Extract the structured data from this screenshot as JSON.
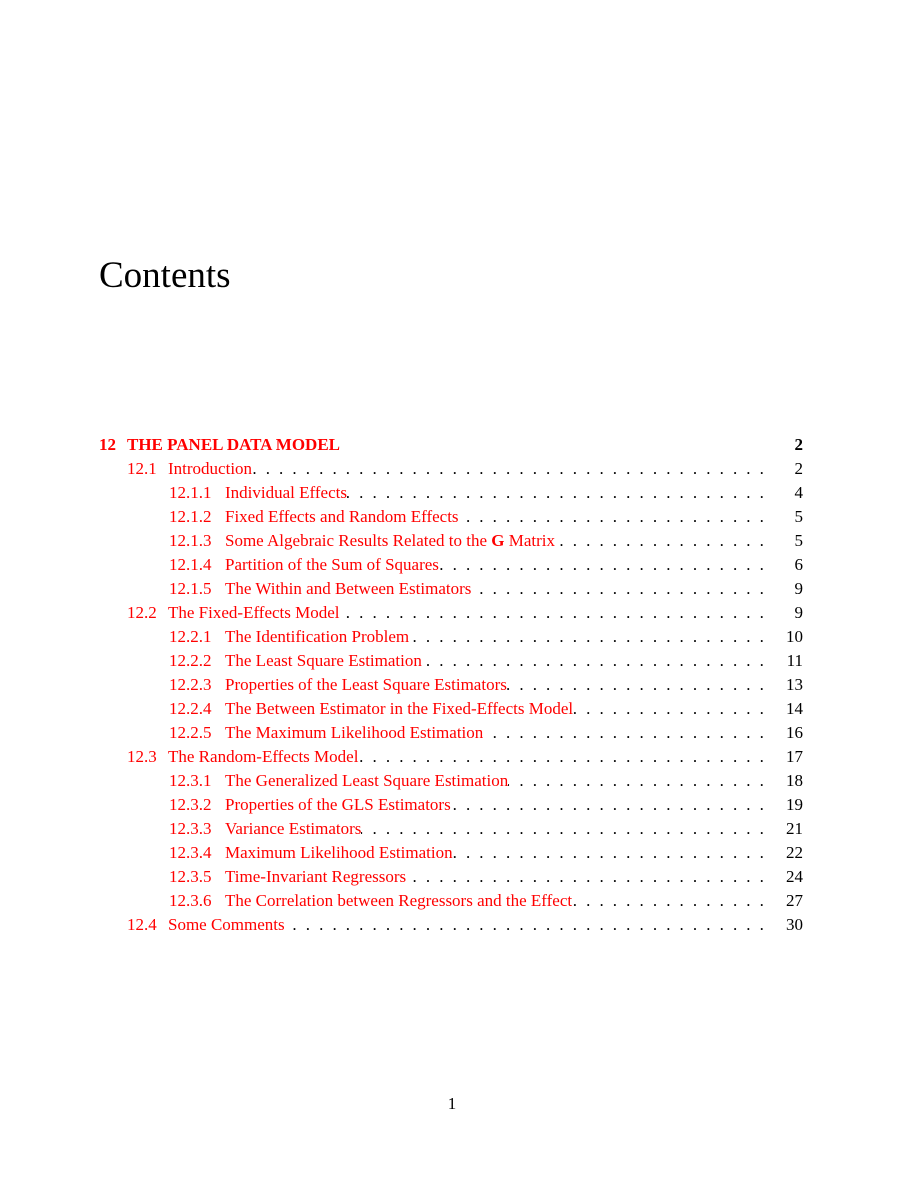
{
  "title": "Contents",
  "page_number": "1",
  "link_color": "#ff0000",
  "toc": {
    "chapter": {
      "num": "12",
      "label": "THE PANEL DATA MODEL",
      "page": "2"
    },
    "entries": [
      {
        "level": "section",
        "num": "12.1",
        "label": "Introduction",
        "page": "2"
      },
      {
        "level": "subsection",
        "num": "12.1.1",
        "label": "Individual Effects",
        "page": "4"
      },
      {
        "level": "subsection",
        "num": "12.1.2",
        "label": "Fixed Effects and Random Effects",
        "page": "5"
      },
      {
        "level": "subsection",
        "num": "12.1.3",
        "label_pre": "Some Algebraic Results Related to the ",
        "label_bold": "G",
        "label_post": " Matrix",
        "page": "5"
      },
      {
        "level": "subsection",
        "num": "12.1.4",
        "label": "Partition of the Sum of Squares",
        "page": "6"
      },
      {
        "level": "subsection",
        "num": "12.1.5",
        "label": "The Within and Between Estimators",
        "page": "9"
      },
      {
        "level": "section",
        "num": "12.2",
        "label": "The Fixed-Effects Model",
        "page": "9"
      },
      {
        "level": "subsection",
        "num": "12.2.1",
        "label": "The Identification Problem",
        "page": "10"
      },
      {
        "level": "subsection",
        "num": "12.2.2",
        "label": "The Least Square Estimation",
        "page": "11"
      },
      {
        "level": "subsection",
        "num": "12.2.3",
        "label": "Properties of the Least Square Estimators",
        "page": "13"
      },
      {
        "level": "subsection",
        "num": "12.2.4",
        "label": "The Between Estimator in the Fixed-Effects Model",
        "page": "14"
      },
      {
        "level": "subsection",
        "num": "12.2.5",
        "label": "The Maximum Likelihood Estimation",
        "page": "16"
      },
      {
        "level": "section",
        "num": "12.3",
        "label": "The Random-Effects Model",
        "page": "17"
      },
      {
        "level": "subsection",
        "num": "12.3.1",
        "label": "The Generalized Least Square Estimation",
        "page": "18"
      },
      {
        "level": "subsection",
        "num": "12.3.2",
        "label": "Properties of the GLS Estimators",
        "page": "19"
      },
      {
        "level": "subsection",
        "num": "12.3.3",
        "label": "Variance Estimators",
        "page": "21"
      },
      {
        "level": "subsection",
        "num": "12.3.4",
        "label": "Maximum Likelihood Estimation",
        "page": "22"
      },
      {
        "level": "subsection",
        "num": "12.3.5",
        "label": "Time-Invariant Regressors",
        "page": "24"
      },
      {
        "level": "subsection",
        "num": "12.3.6",
        "label": "The Correlation between Regressors and the Effect",
        "page": "27"
      },
      {
        "level": "section",
        "num": "12.4",
        "label": "Some Comments",
        "page": "30"
      }
    ]
  }
}
